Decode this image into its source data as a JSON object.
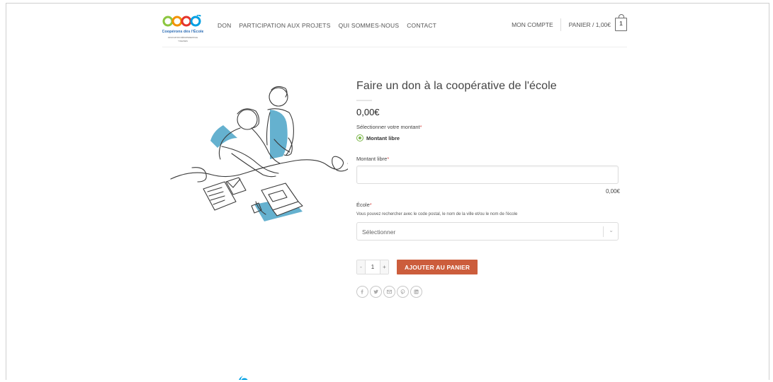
{
  "logo": {
    "tagline": "Coopérons dès l'École",
    "association": "ASSOCIATION DÉPARTEMENTALE",
    "region": "YVELINES"
  },
  "nav": {
    "items": [
      {
        "label": "DON"
      },
      {
        "label": "PARTICIPATION AUX PROJETS"
      },
      {
        "label": "QUI SOMMES-NOUS"
      },
      {
        "label": "CONTACT"
      }
    ],
    "account_label": "MON COMPTE",
    "cart_label": "PANIER / 1,00€",
    "cart_count": "1"
  },
  "product": {
    "title": "Faire un don à la coopérative de l'école",
    "price": "0,00€",
    "amount_label": "Sélectionner votre montant",
    "amount_option": "Montant libre",
    "free_amount_label": "Montant libre",
    "free_amount_value": "",
    "free_amount_display": "0,00€",
    "school_label": "École",
    "school_helper": "Vous pouvez rechercher avec le code postal, le nom de la ville et/ou le nom de l'école",
    "school_placeholder": "Sélectionner",
    "required_mark": "*",
    "quantity": "1",
    "qty_minus": "-",
    "qty_plus": "+",
    "add_to_cart_label": "AJOUTER AU PANIER"
  },
  "share": {
    "icons": [
      "facebook-icon",
      "twitter-icon",
      "email-icon",
      "pinterest-icon",
      "linkedin-icon"
    ]
  },
  "colors": {
    "accent": "#cc5d3c",
    "radio": "#7ab648",
    "logo_green": "#8cc63f",
    "logo_orange": "#f39200",
    "logo_red": "#e5332a",
    "logo_blue": "#009fe3",
    "illustration_blue": "#4aa3c7"
  }
}
